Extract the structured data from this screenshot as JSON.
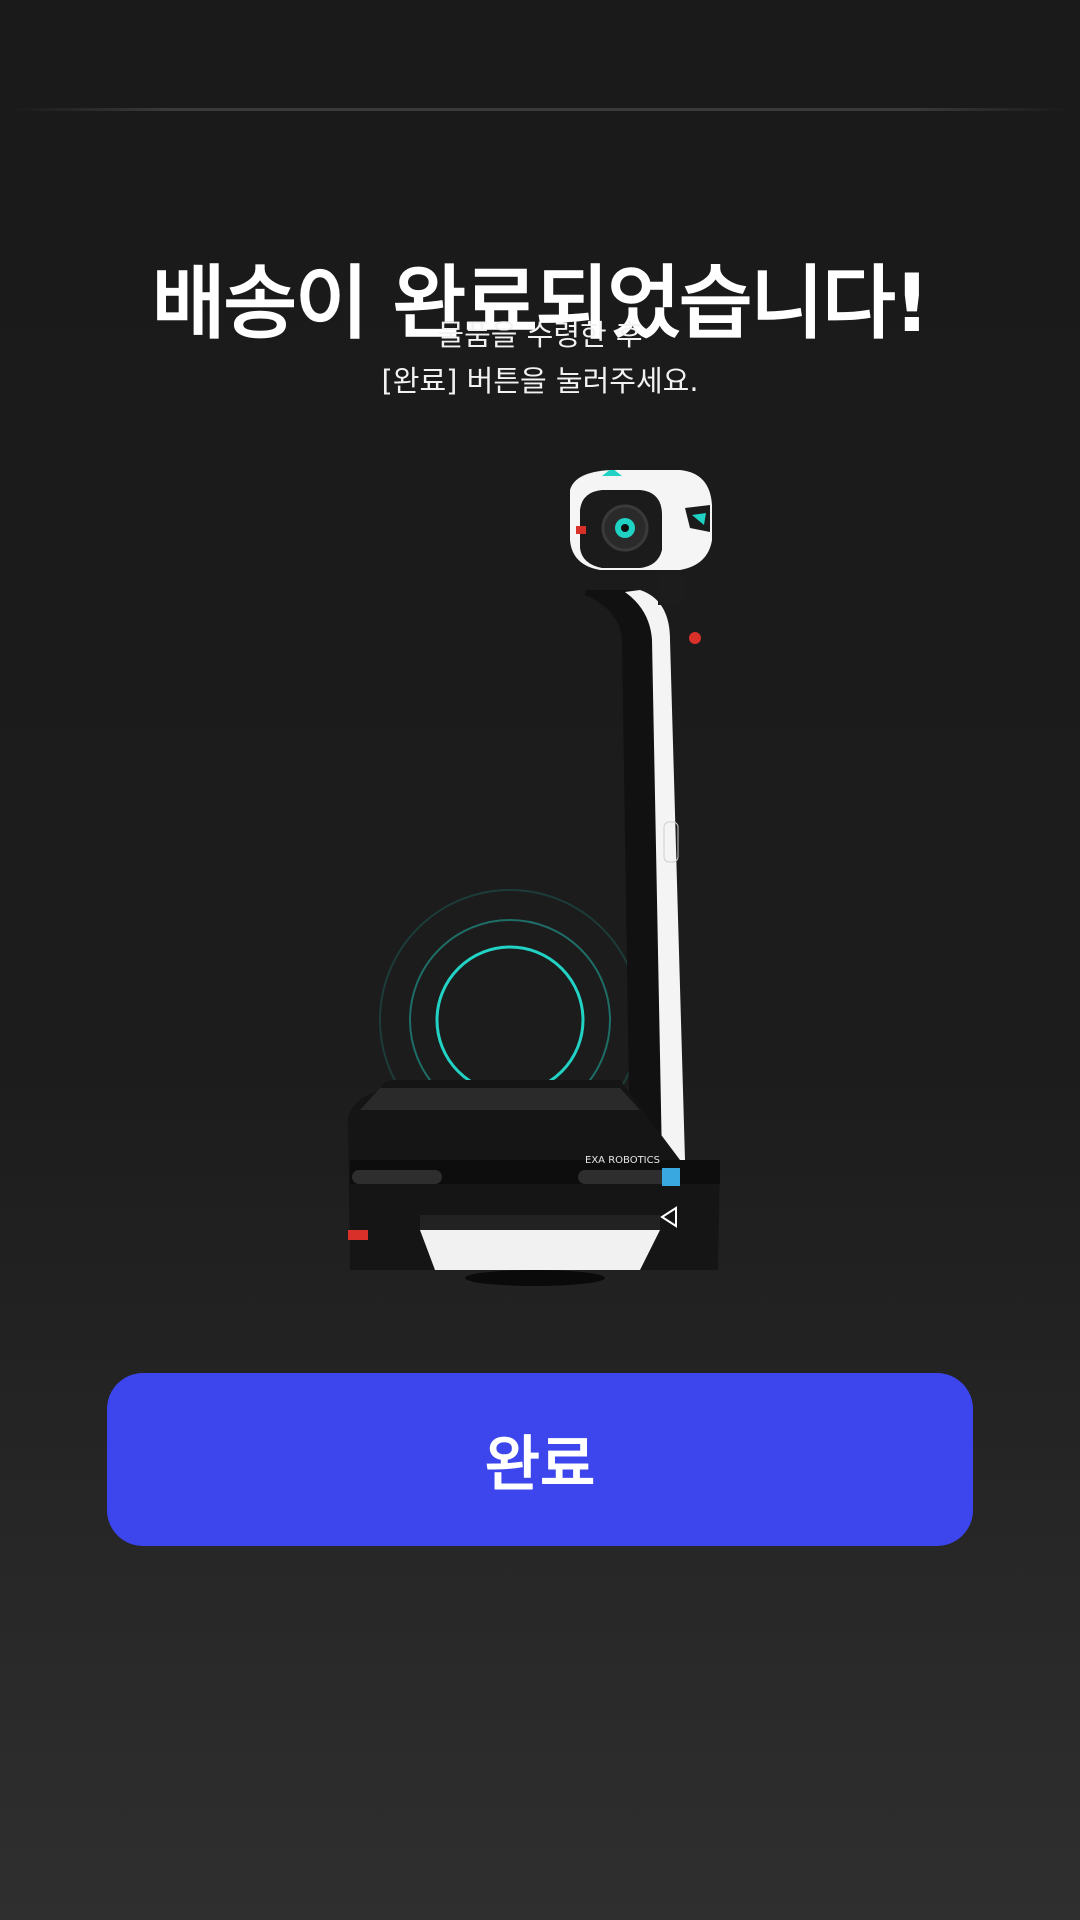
{
  "delivery": {
    "title": "배송이 완료되었습니다!",
    "subtitle_line1": "물품을 수령한 후",
    "subtitle_line2": "[완료] 버튼을 눌러주세요.",
    "robot_brand": "EXA ROBOTICS",
    "complete_button_label": "완료"
  },
  "colors": {
    "background": "#1a1a1a",
    "button": "#3c46ec",
    "accent_ring": "#22d3c5"
  }
}
